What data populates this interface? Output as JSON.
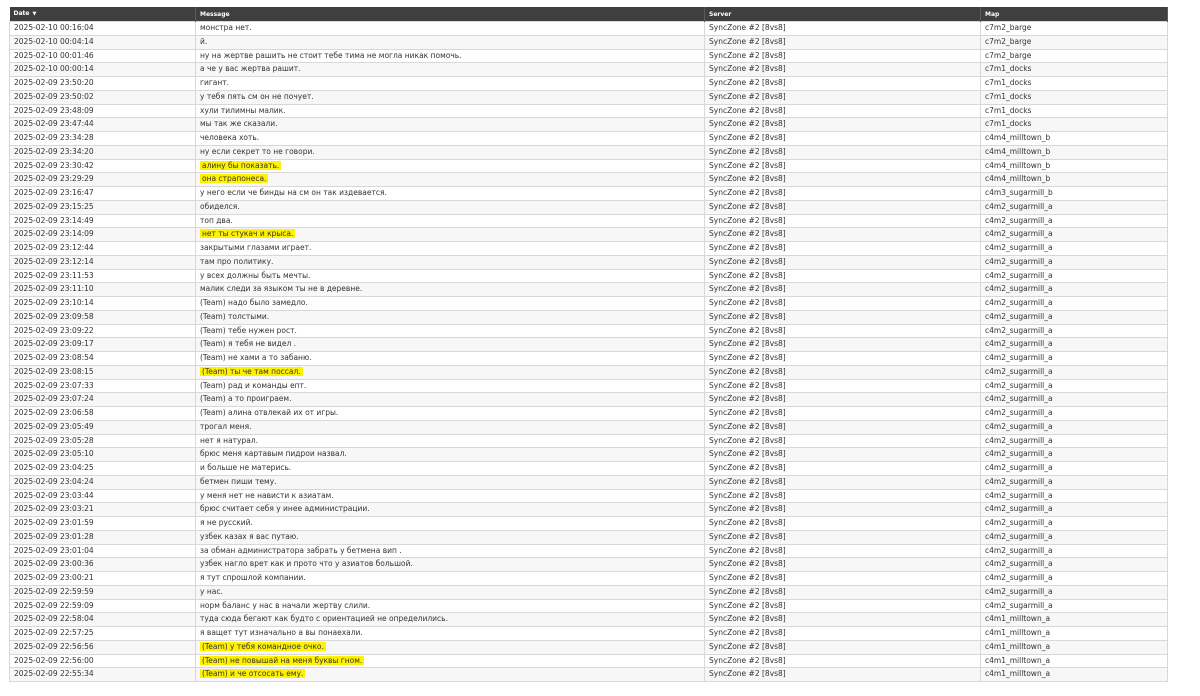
{
  "headers": {
    "date": "Date",
    "message": "Message",
    "server": "Server",
    "map": "Map",
    "sort_indicator": "▼"
  },
  "rows": [
    {
      "date": "2025-02-10 00:16:04",
      "pre": "",
      "msg": "монстра нет.",
      "hl": false,
      "server": "SyncZone #2 [8vs8]",
      "map": "c7m2_barge"
    },
    {
      "date": "2025-02-10 00:04:14",
      "pre": "",
      "msg": "й.",
      "hl": false,
      "server": "SyncZone #2 [8vs8]",
      "map": "c7m2_barge"
    },
    {
      "date": "2025-02-10 00:01:46",
      "pre": "",
      "msg": "ну на жертве рашить не стоит тебе тима не могла никак помочь.",
      "hl": false,
      "server": "SyncZone #2 [8vs8]",
      "map": "c7m2_barge"
    },
    {
      "date": "2025-02-10 00:00:14",
      "pre": "",
      "msg": "а че у вас жертва рашит.",
      "hl": false,
      "server": "SyncZone #2 [8vs8]",
      "map": "c7m1_docks"
    },
    {
      "date": "2025-02-09 23:50:20",
      "pre": "",
      "msg": "гигант.",
      "hl": false,
      "server": "SyncZone #2 [8vs8]",
      "map": "c7m1_docks"
    },
    {
      "date": "2025-02-09 23:50:02",
      "pre": "",
      "msg": "у тебя пять см он не почует.",
      "hl": false,
      "server": "SyncZone #2 [8vs8]",
      "map": "c7m1_docks"
    },
    {
      "date": "2025-02-09 23:48:09",
      "pre": "",
      "msg": "хули тилимны малик.",
      "hl": false,
      "server": "SyncZone #2 [8vs8]",
      "map": "c7m1_docks"
    },
    {
      "date": "2025-02-09 23:47:44",
      "pre": "",
      "msg": "мы так же сказали.",
      "hl": false,
      "server": "SyncZone #2 [8vs8]",
      "map": "c7m1_docks"
    },
    {
      "date": "2025-02-09 23:34:28",
      "pre": "",
      "msg": "человека хоть.",
      "hl": false,
      "server": "SyncZone #2 [8vs8]",
      "map": "c4m4_milltown_b"
    },
    {
      "date": "2025-02-09 23:34:20",
      "pre": "",
      "msg": "ну если секрет то не говори.",
      "hl": false,
      "server": "SyncZone #2 [8vs8]",
      "map": "c4m4_milltown_b"
    },
    {
      "date": "2025-02-09 23:30:42",
      "pre": "",
      "msg": "алину бы показать.",
      "hl": true,
      "server": "SyncZone #2 [8vs8]",
      "map": "c4m4_milltown_b"
    },
    {
      "date": "2025-02-09 23:29:29",
      "pre": "",
      "msg": "она страпонеса.",
      "hl": true,
      "server": "SyncZone #2 [8vs8]",
      "map": "c4m4_milltown_b"
    },
    {
      "date": "2025-02-09 23:16:47",
      "pre": "",
      "msg": "у него если че бинды на см он так издевается.",
      "hl": false,
      "server": "SyncZone #2 [8vs8]",
      "map": "c4m3_sugarmill_b"
    },
    {
      "date": "2025-02-09 23:15:25",
      "pre": "",
      "msg": "обиделся.",
      "hl": false,
      "server": "SyncZone #2 [8vs8]",
      "map": "c4m2_sugarmill_a"
    },
    {
      "date": "2025-02-09 23:14:49",
      "pre": "",
      "msg": "топ два.",
      "hl": false,
      "server": "SyncZone #2 [8vs8]",
      "map": "c4m2_sugarmill_a"
    },
    {
      "date": "2025-02-09 23:14:09",
      "pre": "",
      "msg": "нет ты стукач и крыса.",
      "hl": true,
      "server": "SyncZone #2 [8vs8]",
      "map": "c4m2_sugarmill_a"
    },
    {
      "date": "2025-02-09 23:12:44",
      "pre": "",
      "msg": "закрытыми глазами играет.",
      "hl": false,
      "server": "SyncZone #2 [8vs8]",
      "map": "c4m2_sugarmill_a"
    },
    {
      "date": "2025-02-09 23:12:14",
      "pre": "",
      "msg": "там про политику.",
      "hl": false,
      "server": "SyncZone #2 [8vs8]",
      "map": "c4m2_sugarmill_a"
    },
    {
      "date": "2025-02-09 23:11:53",
      "pre": "",
      "msg": "у всех должны быть мечты.",
      "hl": false,
      "server": "SyncZone #2 [8vs8]",
      "map": "c4m2_sugarmill_a"
    },
    {
      "date": "2025-02-09 23:11:10",
      "pre": "",
      "msg": "малик следи за языком ты не в деревне.",
      "hl": false,
      "server": "SyncZone #2 [8vs8]",
      "map": "c4m2_sugarmill_a"
    },
    {
      "date": "2025-02-09 23:10:14",
      "pre": "",
      "msg": "(Team) надо было замедло.",
      "hl": false,
      "server": "SyncZone #2 [8vs8]",
      "map": "c4m2_sugarmill_a"
    },
    {
      "date": "2025-02-09 23:09:58",
      "pre": "",
      "msg": "(Team) толстыми.",
      "hl": false,
      "server": "SyncZone #2 [8vs8]",
      "map": "c4m2_sugarmill_a"
    },
    {
      "date": "2025-02-09 23:09:22",
      "pre": "",
      "msg": "(Team) тебе нужен рост.",
      "hl": false,
      "server": "SyncZone #2 [8vs8]",
      "map": "c4m2_sugarmill_a"
    },
    {
      "date": "2025-02-09 23:09:17",
      "pre": "",
      "msg": "(Team) я тебя не видел .",
      "hl": false,
      "server": "SyncZone #2 [8vs8]",
      "map": "c4m2_sugarmill_a"
    },
    {
      "date": "2025-02-09 23:08:54",
      "pre": "",
      "msg": "(Team) не хами а то забаню.",
      "hl": false,
      "server": "SyncZone #2 [8vs8]",
      "map": "c4m2_sugarmill_a"
    },
    {
      "date": "2025-02-09 23:08:15",
      "pre": "",
      "msg": "(Team) ты че там поссал.",
      "hl": true,
      "server": "SyncZone #2 [8vs8]",
      "map": "c4m2_sugarmill_a"
    },
    {
      "date": "2025-02-09 23:07:33",
      "pre": "",
      "msg": "(Team) рад и команды епт.",
      "hl": false,
      "server": "SyncZone #2 [8vs8]",
      "map": "c4m2_sugarmill_a"
    },
    {
      "date": "2025-02-09 23:07:24",
      "pre": "",
      "msg": "(Team) а то проиграем.",
      "hl": false,
      "server": "SyncZone #2 [8vs8]",
      "map": "c4m2_sugarmill_a"
    },
    {
      "date": "2025-02-09 23:06:58",
      "pre": "",
      "msg": "(Team) алина отвлекай их от игры.",
      "hl": false,
      "server": "SyncZone #2 [8vs8]",
      "map": "c4m2_sugarmill_a"
    },
    {
      "date": "2025-02-09 23:05:49",
      "pre": "",
      "msg": "трогал меня.",
      "hl": false,
      "server": "SyncZone #2 [8vs8]",
      "map": "c4m2_sugarmill_a"
    },
    {
      "date": "2025-02-09 23:05:28",
      "pre": "",
      "msg": "нет я натурал.",
      "hl": false,
      "server": "SyncZone #2 [8vs8]",
      "map": "c4m2_sugarmill_a"
    },
    {
      "date": "2025-02-09 23:05:10",
      "pre": "",
      "msg": "брюс меня картавым пидрои назвал.",
      "hl": false,
      "server": "SyncZone #2 [8vs8]",
      "map": "c4m2_sugarmill_a"
    },
    {
      "date": "2025-02-09 23:04:25",
      "pre": "",
      "msg": "и больше не матерись.",
      "hl": false,
      "server": "SyncZone #2 [8vs8]",
      "map": "c4m2_sugarmill_a"
    },
    {
      "date": "2025-02-09 23:04:24",
      "pre": "",
      "msg": "бетмен пиши тему.",
      "hl": false,
      "server": "SyncZone #2 [8vs8]",
      "map": "c4m2_sugarmill_a"
    },
    {
      "date": "2025-02-09 23:03:44",
      "pre": "",
      "msg": "у меня нет не нависти к азиатам.",
      "hl": false,
      "server": "SyncZone #2 [8vs8]",
      "map": "c4m2_sugarmill_a"
    },
    {
      "date": "2025-02-09 23:03:21",
      "pre": "",
      "msg": "брюс считает себя у инее администрации.",
      "hl": false,
      "server": "SyncZone #2 [8vs8]",
      "map": "c4m2_sugarmill_a"
    },
    {
      "date": "2025-02-09 23:01:59",
      "pre": "",
      "msg": "я не русский.",
      "hl": false,
      "server": "SyncZone #2 [8vs8]",
      "map": "c4m2_sugarmill_a"
    },
    {
      "date": "2025-02-09 23:01:28",
      "pre": "",
      "msg": "узбек казах я вас путаю.",
      "hl": false,
      "server": "SyncZone #2 [8vs8]",
      "map": "c4m2_sugarmill_a"
    },
    {
      "date": "2025-02-09 23:01:04",
      "pre": "",
      "msg": "за обман администратора забрать у бетмена вип .",
      "hl": false,
      "server": "SyncZone #2 [8vs8]",
      "map": "c4m2_sugarmill_a"
    },
    {
      "date": "2025-02-09 23:00:36",
      "pre": "",
      "msg": "узбек нагло врет как и прото что у азиатов большой.",
      "hl": false,
      "server": "SyncZone #2 [8vs8]",
      "map": "c4m2_sugarmill_a"
    },
    {
      "date": "2025-02-09 23:00:21",
      "pre": "",
      "msg": "я тут спрошлой компании.",
      "hl": false,
      "server": "SyncZone #2 [8vs8]",
      "map": "c4m2_sugarmill_a"
    },
    {
      "date": "2025-02-09 22:59:59",
      "pre": "",
      "msg": "у нас.",
      "hl": false,
      "server": "SyncZone #2 [8vs8]",
      "map": "c4m2_sugarmill_a"
    },
    {
      "date": "2025-02-09 22:59:09",
      "pre": "",
      "msg": "норм баланс у нас в начали жертву слили.",
      "hl": false,
      "server": "SyncZone #2 [8vs8]",
      "map": "c4m2_sugarmill_a"
    },
    {
      "date": "2025-02-09 22:58:04",
      "pre": "",
      "msg": "туда сюда бегают как будто с ориентацией не определились.",
      "hl": false,
      "server": "SyncZone #2 [8vs8]",
      "map": "c4m1_milltown_a"
    },
    {
      "date": "2025-02-09 22:57:25",
      "pre": "",
      "msg": "я ващет тут изначально а вы понаехали.",
      "hl": false,
      "server": "SyncZone #2 [8vs8]",
      "map": "c4m1_milltown_a"
    },
    {
      "date": "2025-02-09 22:56:56",
      "pre": "",
      "msg": "(Team) у тебя командное очко.",
      "hl": true,
      "server": "SyncZone #2 [8vs8]",
      "map": "c4m1_milltown_a"
    },
    {
      "date": "2025-02-09 22:56:00",
      "pre": "",
      "msg": "(Team) не повышай на меня буквы гном.",
      "hl": true,
      "server": "SyncZone #2 [8vs8]",
      "map": "c4m1_milltown_a"
    },
    {
      "date": "2025-02-09 22:55:34",
      "pre": "",
      "msg": "(Team) и че отсосать ему.",
      "hl": true,
      "server": "SyncZone #2 [8vs8]",
      "map": "c4m1_milltown_a"
    }
  ]
}
